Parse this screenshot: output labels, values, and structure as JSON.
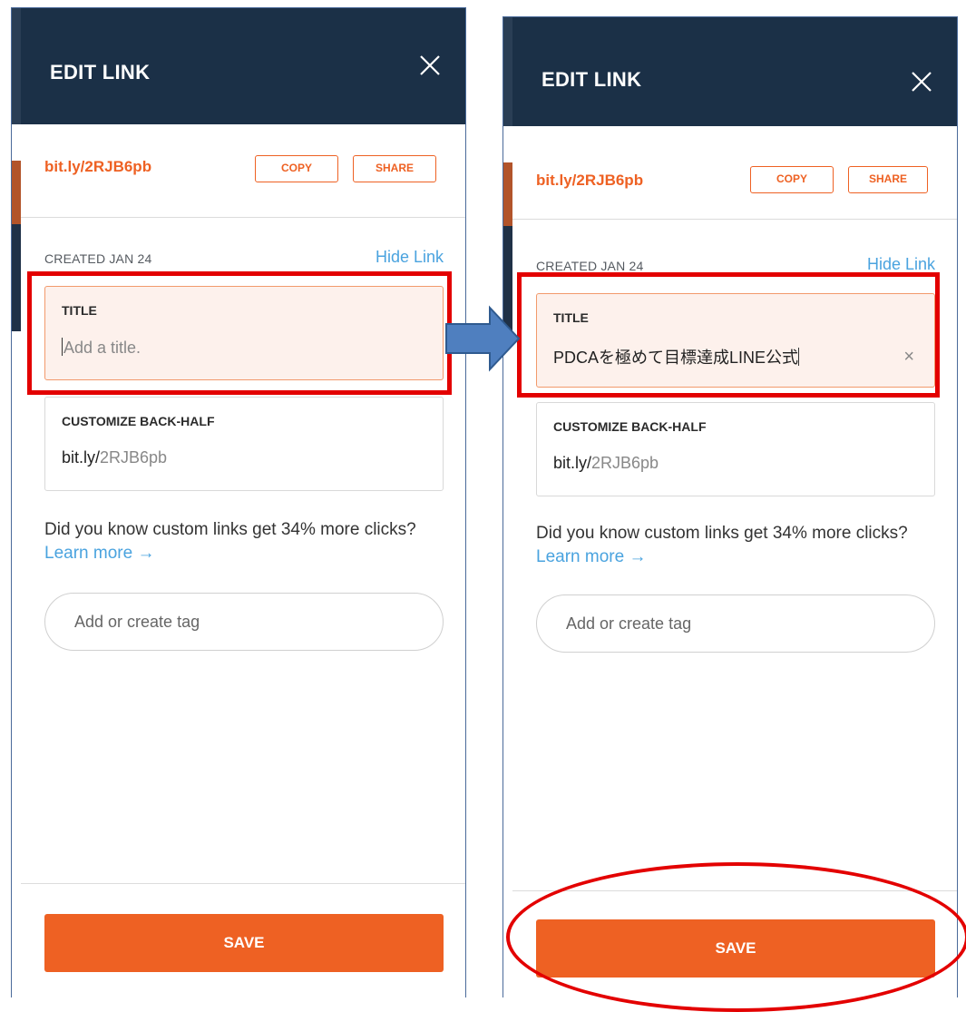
{
  "panels": {
    "before": {
      "header_title": "EDIT LINK",
      "short_link": "bit.ly/2RJB6pb",
      "copy_label": "COPY",
      "share_label": "SHARE",
      "created": "CREATED JAN 24",
      "hide_link": "Hide Link",
      "title_label": "TITLE",
      "title_placeholder": "Add a title.",
      "backhalf_label": "CUSTOMIZE BACK-HALF",
      "backhalf_domain": "bit.ly/",
      "backhalf_value": "2RJB6pb",
      "hint_text": "Did you know custom links get 34% more clicks?",
      "learn_more": "Learn more →",
      "tag_placeholder": "Add or create tag",
      "save_label": "SAVE"
    },
    "after": {
      "header_title": "EDIT LINK",
      "short_link": "bit.ly/2RJB6pb",
      "copy_label": "COPY",
      "share_label": "SHARE",
      "created": "CREATED JAN 24",
      "hide_link": "Hide Link",
      "title_label": "TITLE",
      "title_value": "PDCAを極めて目標達成LINE公式",
      "clear_icon": "×",
      "backhalf_label": "CUSTOMIZE BACK-HALF",
      "backhalf_domain": "bit.ly/",
      "backhalf_value": "2RJB6pb",
      "hint_text": "Did you know custom links get 34% more clicks?",
      "learn_more": "Learn more →",
      "tag_placeholder": "Add or create tag",
      "save_label": "SAVE"
    }
  },
  "colors": {
    "header_bg": "#1b3047",
    "accent_orange": "#ee6123",
    "link_blue": "#4aa3df",
    "annotation_red": "#e30000",
    "arrow_blue": "#4f7fbf"
  },
  "icons": [
    "close-icon",
    "clear-icon",
    "arrow-right-icon"
  ]
}
